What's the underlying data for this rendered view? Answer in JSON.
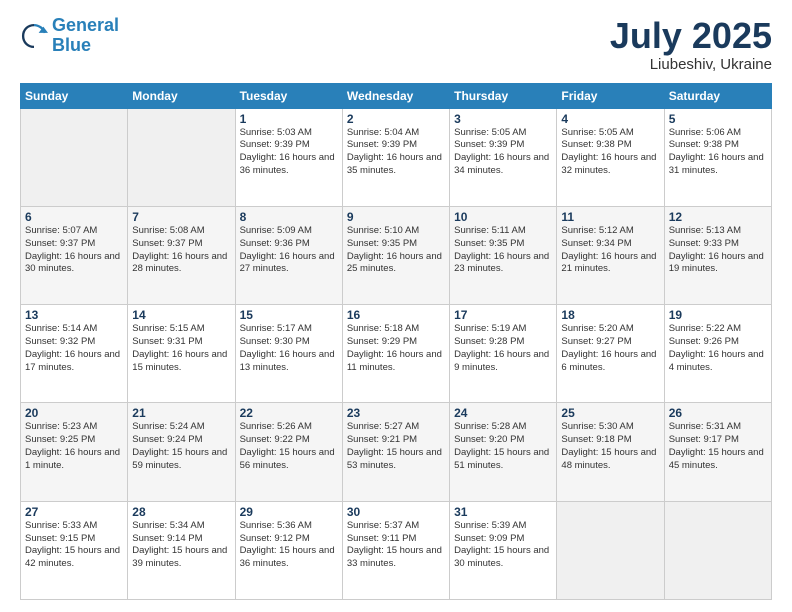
{
  "header": {
    "logo_line1": "General",
    "logo_line2": "Blue",
    "month": "July 2025",
    "location": "Liubeshiv, Ukraine"
  },
  "days_of_week": [
    "Sunday",
    "Monday",
    "Tuesday",
    "Wednesday",
    "Thursday",
    "Friday",
    "Saturday"
  ],
  "weeks": [
    [
      {
        "day": "",
        "info": ""
      },
      {
        "day": "",
        "info": ""
      },
      {
        "day": "1",
        "info": "Sunrise: 5:03 AM\nSunset: 9:39 PM\nDaylight: 16 hours\nand 36 minutes."
      },
      {
        "day": "2",
        "info": "Sunrise: 5:04 AM\nSunset: 9:39 PM\nDaylight: 16 hours\nand 35 minutes."
      },
      {
        "day": "3",
        "info": "Sunrise: 5:05 AM\nSunset: 9:39 PM\nDaylight: 16 hours\nand 34 minutes."
      },
      {
        "day": "4",
        "info": "Sunrise: 5:05 AM\nSunset: 9:38 PM\nDaylight: 16 hours\nand 32 minutes."
      },
      {
        "day": "5",
        "info": "Sunrise: 5:06 AM\nSunset: 9:38 PM\nDaylight: 16 hours\nand 31 minutes."
      }
    ],
    [
      {
        "day": "6",
        "info": "Sunrise: 5:07 AM\nSunset: 9:37 PM\nDaylight: 16 hours\nand 30 minutes."
      },
      {
        "day": "7",
        "info": "Sunrise: 5:08 AM\nSunset: 9:37 PM\nDaylight: 16 hours\nand 28 minutes."
      },
      {
        "day": "8",
        "info": "Sunrise: 5:09 AM\nSunset: 9:36 PM\nDaylight: 16 hours\nand 27 minutes."
      },
      {
        "day": "9",
        "info": "Sunrise: 5:10 AM\nSunset: 9:35 PM\nDaylight: 16 hours\nand 25 minutes."
      },
      {
        "day": "10",
        "info": "Sunrise: 5:11 AM\nSunset: 9:35 PM\nDaylight: 16 hours\nand 23 minutes."
      },
      {
        "day": "11",
        "info": "Sunrise: 5:12 AM\nSunset: 9:34 PM\nDaylight: 16 hours\nand 21 minutes."
      },
      {
        "day": "12",
        "info": "Sunrise: 5:13 AM\nSunset: 9:33 PM\nDaylight: 16 hours\nand 19 minutes."
      }
    ],
    [
      {
        "day": "13",
        "info": "Sunrise: 5:14 AM\nSunset: 9:32 PM\nDaylight: 16 hours\nand 17 minutes."
      },
      {
        "day": "14",
        "info": "Sunrise: 5:15 AM\nSunset: 9:31 PM\nDaylight: 16 hours\nand 15 minutes."
      },
      {
        "day": "15",
        "info": "Sunrise: 5:17 AM\nSunset: 9:30 PM\nDaylight: 16 hours\nand 13 minutes."
      },
      {
        "day": "16",
        "info": "Sunrise: 5:18 AM\nSunset: 9:29 PM\nDaylight: 16 hours\nand 11 minutes."
      },
      {
        "day": "17",
        "info": "Sunrise: 5:19 AM\nSunset: 9:28 PM\nDaylight: 16 hours\nand 9 minutes."
      },
      {
        "day": "18",
        "info": "Sunrise: 5:20 AM\nSunset: 9:27 PM\nDaylight: 16 hours\nand 6 minutes."
      },
      {
        "day": "19",
        "info": "Sunrise: 5:22 AM\nSunset: 9:26 PM\nDaylight: 16 hours\nand 4 minutes."
      }
    ],
    [
      {
        "day": "20",
        "info": "Sunrise: 5:23 AM\nSunset: 9:25 PM\nDaylight: 16 hours\nand 1 minute."
      },
      {
        "day": "21",
        "info": "Sunrise: 5:24 AM\nSunset: 9:24 PM\nDaylight: 15 hours\nand 59 minutes."
      },
      {
        "day": "22",
        "info": "Sunrise: 5:26 AM\nSunset: 9:22 PM\nDaylight: 15 hours\nand 56 minutes."
      },
      {
        "day": "23",
        "info": "Sunrise: 5:27 AM\nSunset: 9:21 PM\nDaylight: 15 hours\nand 53 minutes."
      },
      {
        "day": "24",
        "info": "Sunrise: 5:28 AM\nSunset: 9:20 PM\nDaylight: 15 hours\nand 51 minutes."
      },
      {
        "day": "25",
        "info": "Sunrise: 5:30 AM\nSunset: 9:18 PM\nDaylight: 15 hours\nand 48 minutes."
      },
      {
        "day": "26",
        "info": "Sunrise: 5:31 AM\nSunset: 9:17 PM\nDaylight: 15 hours\nand 45 minutes."
      }
    ],
    [
      {
        "day": "27",
        "info": "Sunrise: 5:33 AM\nSunset: 9:15 PM\nDaylight: 15 hours\nand 42 minutes."
      },
      {
        "day": "28",
        "info": "Sunrise: 5:34 AM\nSunset: 9:14 PM\nDaylight: 15 hours\nand 39 minutes."
      },
      {
        "day": "29",
        "info": "Sunrise: 5:36 AM\nSunset: 9:12 PM\nDaylight: 15 hours\nand 36 minutes."
      },
      {
        "day": "30",
        "info": "Sunrise: 5:37 AM\nSunset: 9:11 PM\nDaylight: 15 hours\nand 33 minutes."
      },
      {
        "day": "31",
        "info": "Sunrise: 5:39 AM\nSunset: 9:09 PM\nDaylight: 15 hours\nand 30 minutes."
      },
      {
        "day": "",
        "info": ""
      },
      {
        "day": "",
        "info": ""
      }
    ]
  ]
}
